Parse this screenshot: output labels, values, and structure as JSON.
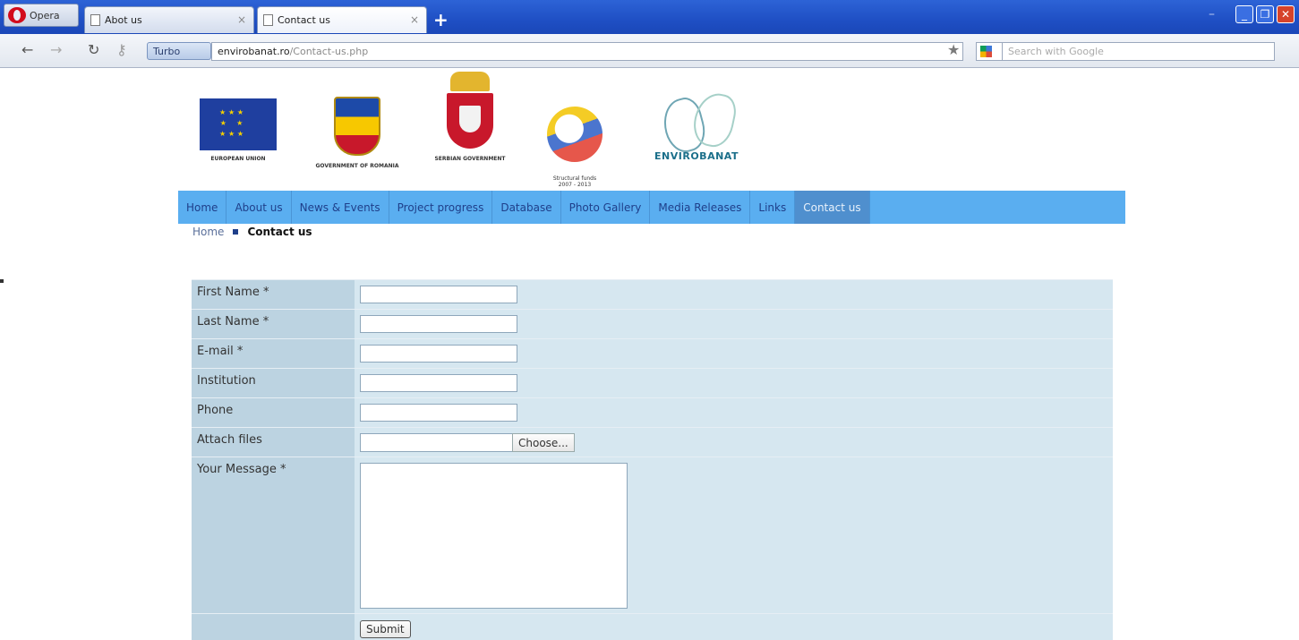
{
  "browser": {
    "menu_label": "Opera",
    "tabs": [
      {
        "label": "Abot us"
      },
      {
        "label": "Contact us"
      }
    ],
    "new_tab_glyph": "+",
    "turbo_label": "Turbo",
    "url_domain": "envirobanat.ro",
    "url_path": "/Contact-us.php",
    "search_placeholder": "Search with Google"
  },
  "logos": [
    {
      "caption": "EUROPEAN UNION",
      "icon": "eu-flag-icon"
    },
    {
      "caption": "GOVERNMENT OF ROMANIA",
      "icon": "romania-crest-icon"
    },
    {
      "caption": "SERBIAN GOVERNMENT",
      "icon": "serbia-crest-icon"
    },
    {
      "caption": "Structural funds\n2007 - 2013",
      "icon": "structural-funds-icon"
    },
    {
      "caption": "ENVIROBANAT",
      "icon": "dove-icon"
    }
  ],
  "menu": {
    "items": [
      {
        "label": "Home"
      },
      {
        "label": "About us"
      },
      {
        "label": "News & Events"
      },
      {
        "label": "Project progress"
      },
      {
        "label": "Database"
      },
      {
        "label": "Photo Gallery"
      },
      {
        "label": "Media Releases"
      },
      {
        "label": "Links"
      },
      {
        "label": "Contact us",
        "active": true
      }
    ]
  },
  "breadcrumb": {
    "home": "Home",
    "current": "Contact us"
  },
  "form": {
    "first_name": "First Name *",
    "last_name": "Last Name *",
    "email": "E-mail *",
    "institution": "Institution",
    "phone": "Phone",
    "attach": "Attach files",
    "choose_button": "Choose...",
    "message": "Your Message *",
    "submit": "Submit"
  },
  "colors": {
    "menu_bg": "#5aaef0",
    "menu_active": "#4f8fce",
    "label_bg": "#bcd3e1",
    "field_bg": "#d6e7f0"
  }
}
